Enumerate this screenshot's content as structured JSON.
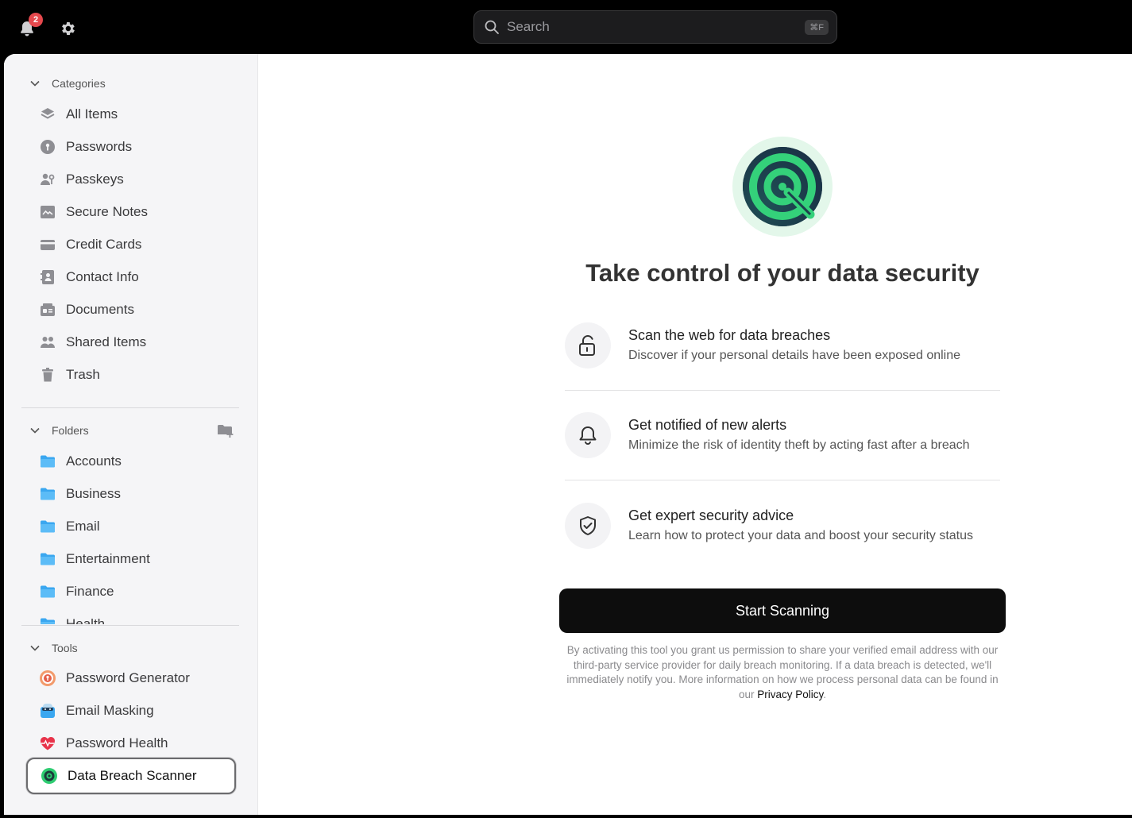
{
  "topbar": {
    "notification_count": "2",
    "search_placeholder": "Search",
    "search_shortcut": "⌘F"
  },
  "sidebar": {
    "categories_label": "Categories",
    "categories": [
      {
        "label": "All Items",
        "icon": "layers-icon"
      },
      {
        "label": "Passwords",
        "icon": "key-icon"
      },
      {
        "label": "Passkeys",
        "icon": "passkey-icon"
      },
      {
        "label": "Secure Notes",
        "icon": "note-icon"
      },
      {
        "label": "Credit Cards",
        "icon": "credit-card-icon"
      },
      {
        "label": "Contact Info",
        "icon": "contact-icon"
      },
      {
        "label": "Documents",
        "icon": "document-icon"
      },
      {
        "label": "Shared Items",
        "icon": "shared-icon"
      },
      {
        "label": "Trash",
        "icon": "trash-icon"
      }
    ],
    "folders_label": "Folders",
    "folders": [
      {
        "label": "Accounts"
      },
      {
        "label": "Business"
      },
      {
        "label": "Email"
      },
      {
        "label": "Entertainment"
      },
      {
        "label": "Finance"
      },
      {
        "label": "Health"
      }
    ],
    "tools_label": "Tools",
    "tools": [
      {
        "label": "Password Generator",
        "icon": "password-generator-icon"
      },
      {
        "label": "Email Masking",
        "icon": "email-masking-icon"
      },
      {
        "label": "Password Health",
        "icon": "heart-pulse-icon"
      },
      {
        "label": "Data Breach Scanner",
        "icon": "breach-scanner-icon",
        "selected": true
      }
    ]
  },
  "main": {
    "headline": "Take control of your data security",
    "features": [
      {
        "title": "Scan the web for data breaches",
        "description": "Discover if your personal details have been exposed online",
        "icon": "unlock-icon"
      },
      {
        "title": "Get notified of new alerts",
        "description": "Minimize the risk of identity theft by acting fast after a breach",
        "icon": "bell-icon"
      },
      {
        "title": "Get expert security advice",
        "description": "Learn how to protect your data and boost your security status",
        "icon": "shield-check-icon"
      }
    ],
    "cta_label": "Start Scanning",
    "disclaimer_text": "By activating this tool you grant us permission to share your verified email address with our third-party service provider for daily breach monitoring. If a data breach is detected, we'll immediately notify you. More information on how we process personal data can be found in our ",
    "privacy_link": "Privacy Policy",
    "disclaimer_end": "."
  },
  "colors": {
    "accent_green": "#2ecc71",
    "button_black": "#0d0d0d",
    "badge_red": "#e5484d",
    "folder_blue": "#3aa7f0"
  }
}
